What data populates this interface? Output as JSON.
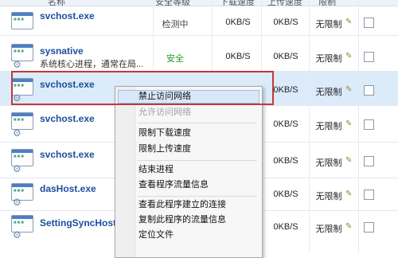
{
  "header": {
    "cols": [
      "名称",
      "安全等级",
      "下载速度",
      "上传速度",
      "限制"
    ]
  },
  "colors": {
    "safe": "#1a9a2a",
    "checking": "#444444",
    "process_name": "#1b4f9c",
    "highlight_border": "#c0393b"
  },
  "rows": [
    {
      "name": "svchost.exe",
      "desc": "",
      "status": "检测中",
      "up": "0KB/S",
      "down": "0KB/S",
      "limit": "无限制"
    },
    {
      "name": "sysnative",
      "desc": "系统核心进程，通常在局...",
      "status": "安全",
      "up": "0KB/S",
      "down": "0KB/S",
      "limit": "无限制"
    },
    {
      "name": "svchost.exe",
      "desc": "",
      "status": "",
      "up": "",
      "down": "0KB/S",
      "limit": "无限制"
    },
    {
      "name": "svchost.exe",
      "desc": "",
      "status": "",
      "up": "",
      "down": "0KB/S",
      "limit": "无限制"
    },
    {
      "name": "svchost.exe",
      "desc": "",
      "status": "",
      "up": "",
      "down": "0KB/S",
      "limit": "无限制"
    },
    {
      "name": "dasHost.exe",
      "desc": "",
      "status": "",
      "up": "",
      "down": "0KB/S",
      "limit": "无限制"
    },
    {
      "name": "SettingSyncHost",
      "desc": "",
      "status": "",
      "up": "",
      "down": "0KB/S",
      "limit": "无限制"
    }
  ],
  "context_menu": {
    "items": [
      {
        "label": "禁止访问网络",
        "state": "hover"
      },
      {
        "label": "允许访问网络",
        "state": "disabled"
      },
      {
        "label": "限制下载速度",
        "state": "normal"
      },
      {
        "label": "限制上传速度",
        "state": "normal"
      },
      {
        "label": "结束进程",
        "state": "normal"
      },
      {
        "label": "查看程序流量信息",
        "state": "normal"
      },
      {
        "label": "查看此程序建立的连接",
        "state": "normal"
      },
      {
        "label": "复制此程序的流量信息",
        "state": "normal"
      },
      {
        "label": "定位文件",
        "state": "normal"
      }
    ]
  }
}
